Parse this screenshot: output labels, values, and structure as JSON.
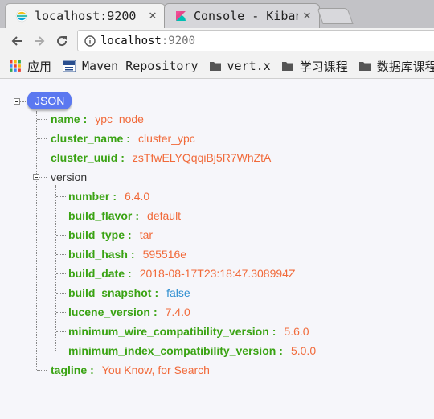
{
  "tabs": [
    {
      "title": "localhost:9200",
      "close": "✕"
    },
    {
      "title": "Console - Kibana",
      "close": "✕"
    }
  ],
  "address": {
    "host": "localhost",
    "port": ":9200"
  },
  "bookmarks": [
    {
      "label": "应用",
      "icon": "apps-grid-icon"
    },
    {
      "label": "Maven Repository",
      "icon": "mvn-icon"
    },
    {
      "label": "vert.x",
      "icon": "folder-icon"
    },
    {
      "label": "学习课程",
      "icon": "folder-icon"
    },
    {
      "label": "数据库课程",
      "icon": "folder-icon"
    },
    {
      "label": "",
      "icon": "folder-icon"
    }
  ],
  "json_view": {
    "root_label": "JSON",
    "name": {
      "key": "name",
      "value": "ypc_node"
    },
    "cluster_name": {
      "key": "cluster_name",
      "value": "cluster_ypc"
    },
    "cluster_uuid": {
      "key": "cluster_uuid",
      "value": "zsTfwELYQqqiBj5R7WhZtA"
    },
    "version": {
      "key": "version",
      "number": {
        "key": "number",
        "value": "6.4.0"
      },
      "build_flavor": {
        "key": "build_flavor",
        "value": "default"
      },
      "build_type": {
        "key": "build_type",
        "value": "tar"
      },
      "build_hash": {
        "key": "build_hash",
        "value": "595516e"
      },
      "build_date": {
        "key": "build_date",
        "value": "2018-08-17T23:18:47.308994Z"
      },
      "build_snapshot": {
        "key": "build_snapshot",
        "value": "false"
      },
      "lucene_version": {
        "key": "lucene_version",
        "value": "7.4.0"
      },
      "minimum_wire_compatibility_version": {
        "key": "minimum_wire_compatibility_version",
        "value": "5.6.0"
      },
      "minimum_index_compatibility_version": {
        "key": "minimum_index_compatibility_version",
        "value": "5.0.0"
      }
    },
    "tagline": {
      "key": "tagline",
      "value": "You Know, for Search"
    },
    "separator": ":"
  },
  "colors": {
    "key": "#3aa313",
    "string": "#f16a3a",
    "boolean": "#2f8fd0",
    "root_badge": "#5b78f0"
  }
}
